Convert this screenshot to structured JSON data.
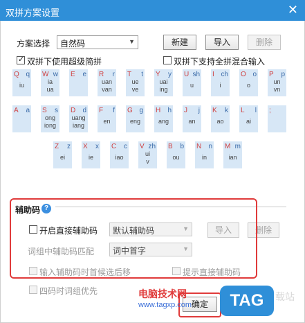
{
  "window": {
    "title": "双拼方案设置",
    "close_glyph": "✕"
  },
  "scheme": {
    "label": "方案选择",
    "value": "自然码",
    "btn_new": "新建",
    "btn_import": "导入",
    "btn_delete": "删除"
  },
  "options": {
    "super_jianpin": "双拼下使用超级简拼",
    "mixed_full": "双拼下支持全拼混合输入"
  },
  "keyboard": {
    "rows": [
      [
        {
          "k": "Q",
          "s": "q",
          "f": [
            "iu"
          ]
        },
        {
          "k": "W",
          "s": "w",
          "f": [
            "ia",
            "ua"
          ]
        },
        {
          "k": "E",
          "s": "e",
          "f": [
            ""
          ]
        },
        {
          "k": "R",
          "s": "r",
          "f": [
            "uan",
            "van"
          ]
        },
        {
          "k": "T",
          "s": "t",
          "f": [
            "ue",
            "ve"
          ]
        },
        {
          "k": "Y",
          "s": "y",
          "f": [
            "uai",
            "ing"
          ]
        },
        {
          "k": "U",
          "s": "sh",
          "f": [
            "u"
          ]
        },
        {
          "k": "I",
          "s": "ch",
          "f": [
            "i"
          ]
        },
        {
          "k": "O",
          "s": "o",
          "f": [
            "o"
          ]
        },
        {
          "k": "P",
          "s": "p",
          "f": [
            "un",
            "vn"
          ]
        }
      ],
      [
        {
          "k": "A",
          "s": "a",
          "f": [
            ""
          ]
        },
        {
          "k": "S",
          "s": "s",
          "f": [
            "ong",
            "iong"
          ]
        },
        {
          "k": "D",
          "s": "d",
          "f": [
            "uang",
            "iang"
          ]
        },
        {
          "k": "F",
          "s": "f",
          "f": [
            "en"
          ]
        },
        {
          "k": "G",
          "s": "g",
          "f": [
            "eng"
          ]
        },
        {
          "k": "H",
          "s": "h",
          "f": [
            "ang"
          ]
        },
        {
          "k": "J",
          "s": "j",
          "f": [
            "an"
          ]
        },
        {
          "k": "K",
          "s": "k",
          "f": [
            "ao"
          ]
        },
        {
          "k": "L",
          "s": "l",
          "f": [
            "ai"
          ]
        },
        {
          "k": ";",
          "s": "",
          "f": [
            ""
          ]
        }
      ],
      [
        {
          "k": "Z",
          "s": "z",
          "f": [
            "ei"
          ]
        },
        {
          "k": "X",
          "s": "x",
          "f": [
            "ie"
          ]
        },
        {
          "k": "C",
          "s": "c",
          "f": [
            "iao"
          ]
        },
        {
          "k": "V",
          "s": "zh",
          "f": [
            "ui",
            "v"
          ]
        },
        {
          "k": "B",
          "s": "b",
          "f": [
            "ou"
          ]
        },
        {
          "k": "N",
          "s": "n",
          "f": [
            "in"
          ]
        },
        {
          "k": "M",
          "s": "m",
          "f": [
            "ian"
          ]
        }
      ]
    ]
  },
  "aux": {
    "section_title": "辅助码",
    "help_glyph": "?",
    "enable_direct": "开启直接辅助码",
    "aux_select": "默认辅助码",
    "btn_import": "导入",
    "btn_delete": "删除",
    "word_match_label": "词组中辅助码匹配",
    "word_match_value": "词中首字",
    "move_back": "输入辅助码时首候选后移",
    "hint_direct": "提示直接辅助码"
  },
  "four_code": "四码时词组优先",
  "ok_button": "确定",
  "watermark": {
    "text": "电脑技术网",
    "url": "www.tagxp.com",
    "badge": "TAG",
    "station": "载站"
  }
}
